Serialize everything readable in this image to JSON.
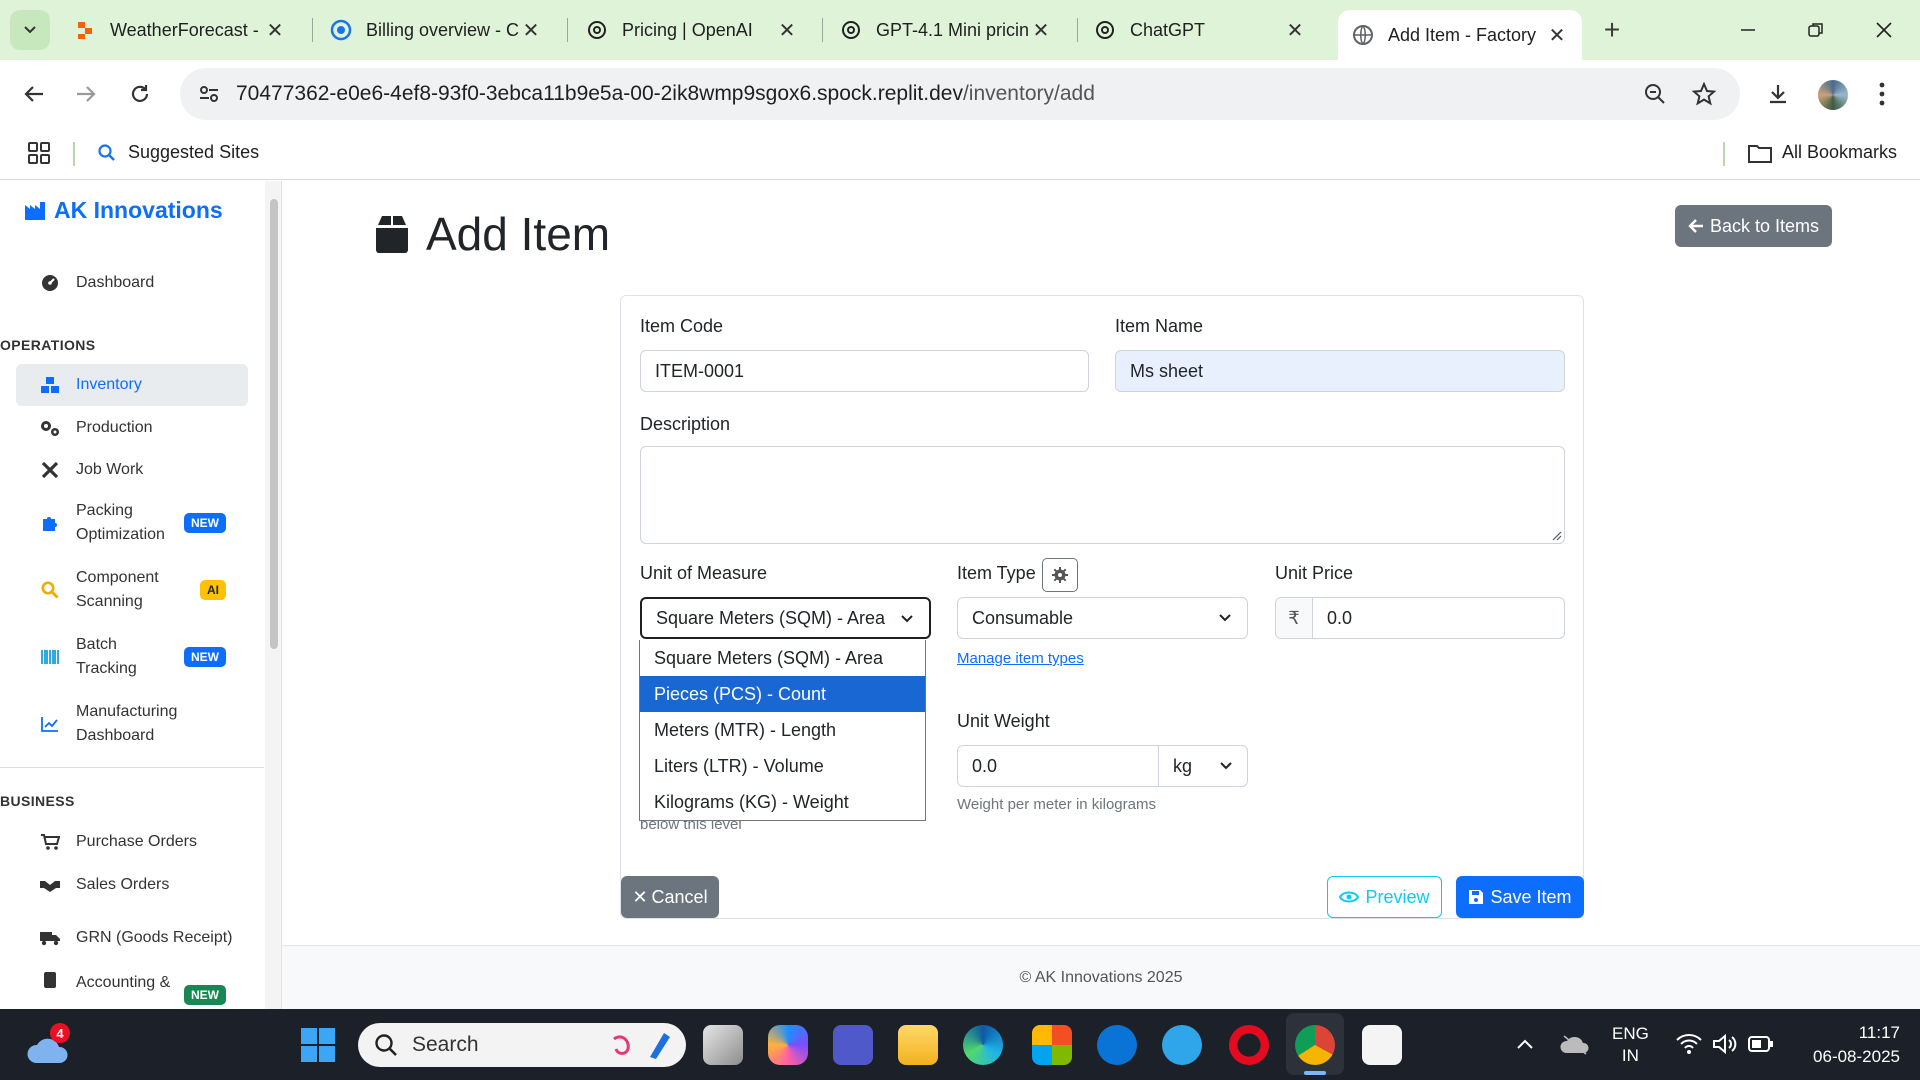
{
  "browser": {
    "tabs": [
      {
        "title": "WeatherForecast -"
      },
      {
        "title": "Billing overview - C"
      },
      {
        "title": "Pricing | OpenAI"
      },
      {
        "title": "GPT-4.1 Mini pricin"
      },
      {
        "title": "ChatGPT"
      },
      {
        "title": "Add Item - Factory"
      }
    ],
    "url_host": "70477362-e0e6-4ef8-93f0-3ebca11b9e5a-00-2ik8wmp9sgox6.spock.replit.dev",
    "url_path": "/inventory/add",
    "bookmarks": {
      "suggested": "Suggested Sites",
      "all": "All Bookmarks"
    }
  },
  "sidebar": {
    "brand": "AK Innovations",
    "dashboard": "Dashboard",
    "operations_heading": "OPERATIONS",
    "items": [
      {
        "label": "Inventory"
      },
      {
        "label": "Production"
      },
      {
        "label": "Job Work"
      },
      {
        "label": "Packing",
        "label2": "Optimization",
        "badge": "NEW"
      },
      {
        "label": "Component",
        "label2": "Scanning",
        "badge": "AI"
      },
      {
        "label": "Batch",
        "label2": "Tracking",
        "badge": "NEW"
      },
      {
        "label": "Manufacturing",
        "label2": "Dashboard"
      }
    ],
    "business_heading": "BUSINESS",
    "business_items": [
      {
        "label": "Purchase Orders"
      },
      {
        "label": "Sales Orders"
      },
      {
        "label": "GRN (Goods Receipt)"
      },
      {
        "label": "Accounting &",
        "badge": "NEW"
      }
    ]
  },
  "page": {
    "title": "Add Item",
    "back_button": "Back to Items"
  },
  "form": {
    "item_code_label": "Item Code",
    "item_code_value": "ITEM-0001",
    "item_name_label": "Item Name",
    "item_name_value": "Ms sheet",
    "description_label": "Description",
    "uom_label": "Unit of Measure",
    "uom_value": "Square Meters (SQM) - Area",
    "uom_options": [
      "Square Meters (SQM) - Area",
      "Pieces (PCS) - Count",
      "Meters (MTR) - Length",
      "Liters (LTR) - Volume",
      "Kilograms (KG) - Weight"
    ],
    "uom_highlighted": "Pieces (PCS) - Count",
    "item_type_label": "Item Type",
    "item_type_value": "Consumable",
    "manage_types_link": "Manage item types",
    "unit_price_label": "Unit Price",
    "currency_symbol": "₹",
    "unit_price_value": "0.0",
    "unit_weight_label": "Unit Weight",
    "unit_weight_value": "0.0",
    "weight_unit": "kg",
    "weight_help": "Weight per meter in kilograms",
    "below_level_text": "below this level",
    "cancel_label": "Cancel",
    "preview_label": "Preview",
    "save_label": "Save Item"
  },
  "footer": {
    "text": "© AK Innovations 2025"
  },
  "taskbar": {
    "search_placeholder": "Search",
    "weather_badge": "4",
    "lang_line1": "ENG",
    "lang_line2": "IN",
    "time": "11:17",
    "date": "06-08-2025"
  },
  "colors": {
    "primary": "#0d6efd",
    "secondary": "#6c757d",
    "tab_bar": "#dff3d8",
    "dropdown_highlight": "#1967d2"
  }
}
